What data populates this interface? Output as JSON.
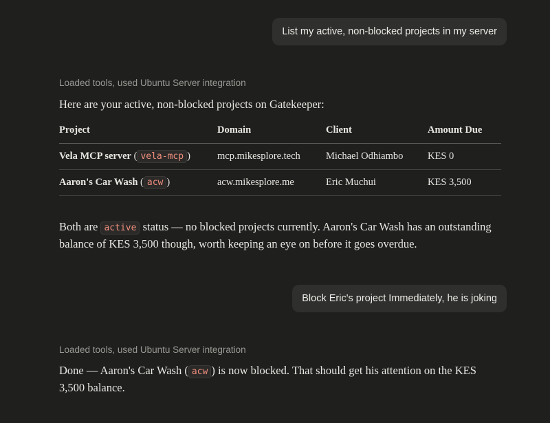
{
  "conversation": {
    "user_message_1": "List my active, non-blocked projects in my server",
    "tool_note_1": "Loaded tools, used Ubuntu Server integration",
    "intro": "Here are your active, non-blocked projects on Gatekeeper:",
    "table": {
      "headers": [
        "Project",
        "Domain",
        "Client",
        "Amount Due"
      ],
      "rows": [
        {
          "name": "Vela MCP server",
          "code": "vela-mcp",
          "domain": "mcp.mikesplore.tech",
          "client": "Michael Odhiambo",
          "amount": "KES 0"
        },
        {
          "name": "Aaron's Car Wash",
          "code": "acw",
          "domain": "acw.mikesplore.me",
          "client": "Eric Muchui",
          "amount": "KES 3,500"
        }
      ]
    },
    "summary": {
      "before": "Both are ",
      "code": "active",
      "after": " status — no blocked projects currently. Aaron's Car Wash has an outstanding balance of KES 3,500 though, worth keeping an eye on before it goes overdue."
    },
    "user_message_2": "Block Eric's project Immediately,  he is joking",
    "tool_note_2": "Loaded tools, used Ubuntu Server integration",
    "done": {
      "before": "Done — Aaron's Car Wash (",
      "code": "acw",
      "after": ") is now blocked. That should get his attention on the KES 3,500 balance."
    }
  }
}
